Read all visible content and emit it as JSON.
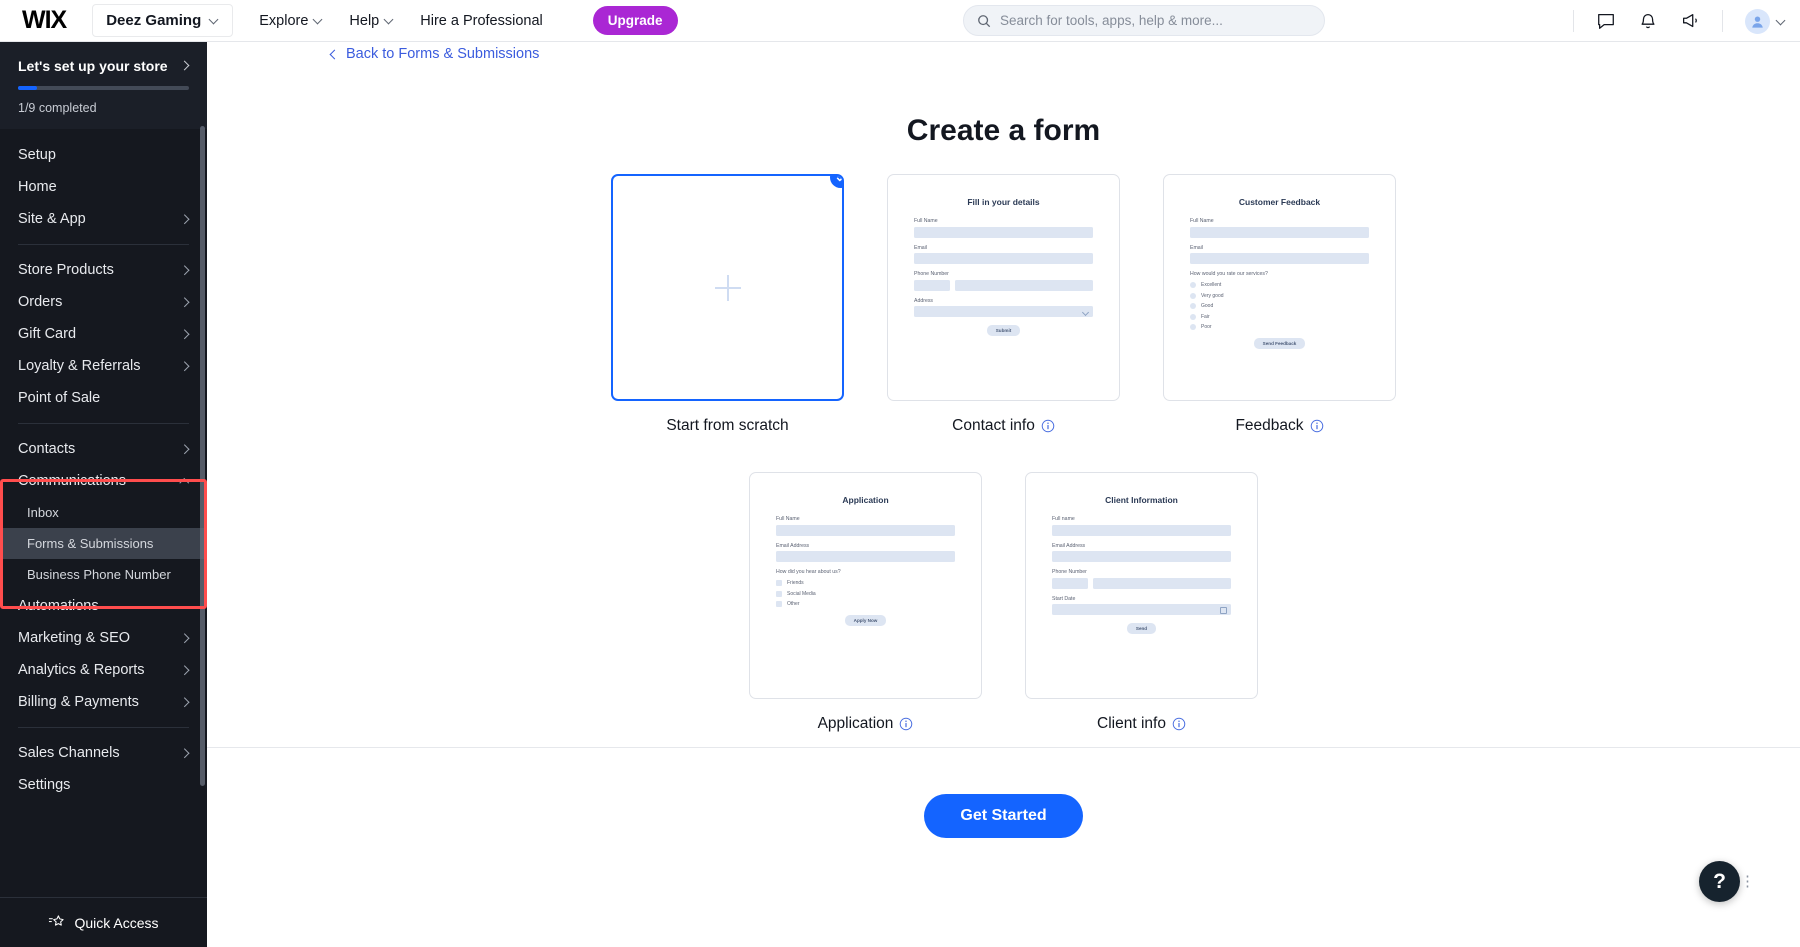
{
  "topbar": {
    "logo": "WIX",
    "site_name": "Deez Gaming",
    "nav": [
      {
        "label": "Explore",
        "has_chevron": true
      },
      {
        "label": "Help",
        "has_chevron": true
      },
      {
        "label": "Hire a Professional",
        "has_chevron": false
      }
    ],
    "upgrade_label": "Upgrade",
    "search_placeholder": "Search for tools, apps, help & more...",
    "icons": [
      "chat-icon",
      "bell-icon",
      "megaphone-icon",
      "avatar"
    ]
  },
  "sidebar": {
    "setup": {
      "title": "Let's set up your store",
      "progress_text": "1/9 completed",
      "progress_percent": 11
    },
    "items": [
      {
        "label": "Setup",
        "arrow": false,
        "sub": false
      },
      {
        "label": "Home",
        "arrow": false,
        "sub": false
      },
      {
        "label": "Site & App",
        "arrow": true,
        "sub": false
      },
      {
        "separator": true
      },
      {
        "label": "Store Products",
        "arrow": true,
        "sub": false
      },
      {
        "label": "Orders",
        "arrow": true,
        "sub": false
      },
      {
        "label": "Gift Card",
        "arrow": true,
        "sub": false
      },
      {
        "label": "Loyalty & Referrals",
        "arrow": true,
        "sub": false
      },
      {
        "label": "Point of Sale",
        "arrow": false,
        "sub": false
      },
      {
        "separator": true
      },
      {
        "label": "Contacts",
        "arrow": true,
        "sub": false
      },
      {
        "label": "Communications",
        "arrow": true,
        "expanded": true,
        "sub": false
      },
      {
        "label": "Inbox",
        "arrow": false,
        "sub": true
      },
      {
        "label": "Forms & Submissions",
        "arrow": false,
        "sub": true,
        "active": true
      },
      {
        "label": "Business Phone Number",
        "arrow": false,
        "sub": true
      },
      {
        "label": "Automations",
        "arrow": false,
        "sub": false
      },
      {
        "label": "Marketing & SEO",
        "arrow": true,
        "sub": false
      },
      {
        "label": "Analytics & Reports",
        "arrow": true,
        "sub": false
      },
      {
        "label": "Billing & Payments",
        "arrow": true,
        "sub": false
      },
      {
        "separator": true
      },
      {
        "label": "Sales Channels",
        "arrow": true,
        "sub": false
      },
      {
        "label": "Settings",
        "arrow": false,
        "sub": false
      }
    ],
    "quick_access": "Quick Access",
    "highlight_color": "#ff4d4d"
  },
  "main": {
    "back_link": "Back to Forms & Submissions",
    "page_title": "Create a form",
    "get_started_label": "Get Started",
    "accent_color": "#1464ff",
    "cards": [
      {
        "id": "start-from-scratch",
        "caption": "Start from scratch",
        "selected": true,
        "has_info": false,
        "preview": "plus"
      },
      {
        "id": "contact-info",
        "caption": "Contact info",
        "selected": false,
        "has_info": true,
        "preview": {
          "title": "Fill in your details",
          "fields": [
            {
              "label": "Full Name",
              "type": "text"
            },
            {
              "label": "Email",
              "type": "text"
            },
            {
              "label": "Phone Number",
              "type": "phone"
            },
            {
              "label": "Address",
              "type": "select"
            }
          ],
          "button": "Submit"
        }
      },
      {
        "id": "feedback",
        "caption": "Feedback",
        "selected": false,
        "has_info": true,
        "preview": {
          "title": "Customer Feedback",
          "fields": [
            {
              "label": "Full Name",
              "type": "text"
            },
            {
              "label": "Email",
              "type": "text"
            }
          ],
          "question": "How would you rate our services?",
          "option_type": "radio",
          "options": [
            "Excellent",
            "Very good",
            "Good",
            "Fair",
            "Poor"
          ],
          "button": "Send Feedback"
        }
      },
      {
        "id": "application",
        "caption": "Application",
        "selected": false,
        "has_info": true,
        "preview": {
          "title": "Application",
          "fields": [
            {
              "label": "Full Name",
              "type": "text"
            },
            {
              "label": "Email Address",
              "type": "text"
            }
          ],
          "question": "How did you hear about us?",
          "option_type": "checkbox",
          "options": [
            "Friends",
            "Social Media",
            "Other"
          ],
          "button": "Apply Now"
        }
      },
      {
        "id": "client-info",
        "caption": "Client info",
        "selected": false,
        "has_info": true,
        "preview": {
          "title": "Client Information",
          "fields": [
            {
              "label": "Full name",
              "type": "text"
            },
            {
              "label": "Email Address",
              "type": "text"
            },
            {
              "label": "Phone Number",
              "type": "phone"
            },
            {
              "label": "Start Date",
              "type": "date"
            }
          ],
          "button": "Send"
        }
      }
    ]
  },
  "help_widget": {
    "icon_label": "?",
    "menu_dots": "⋮"
  }
}
